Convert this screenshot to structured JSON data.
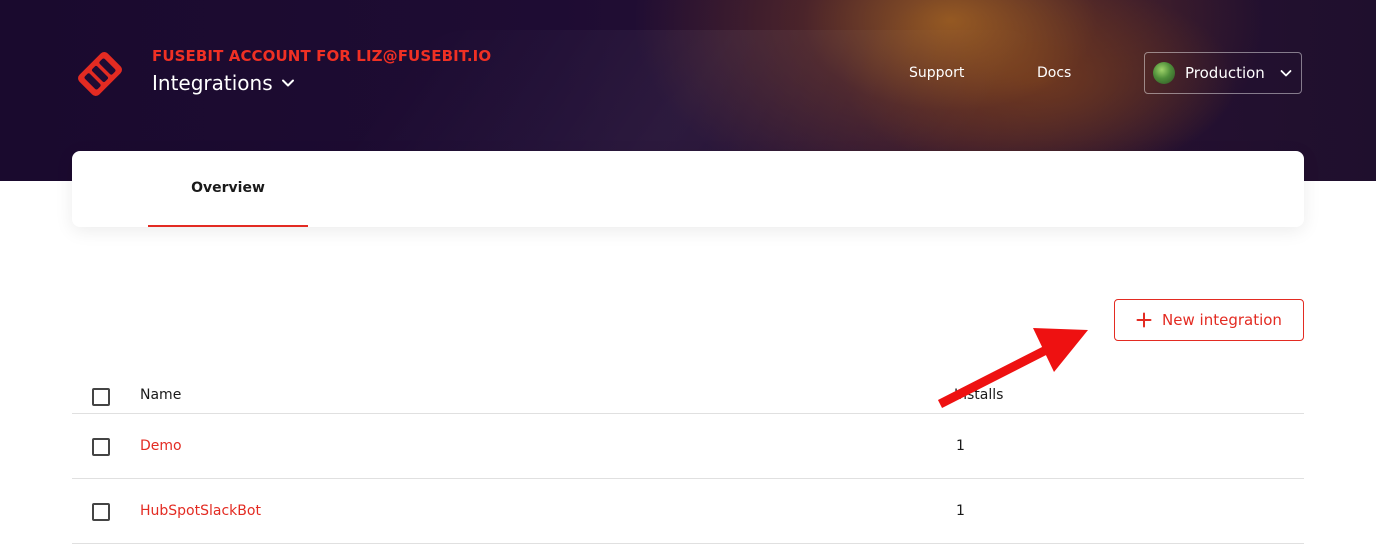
{
  "header": {
    "account_label": "FUSEBIT ACCOUNT FOR LIZ@FUSEBIT.IO",
    "page_title": "Integrations",
    "nav": {
      "support": "Support",
      "docs": "Docs"
    },
    "environment": {
      "selected": "Production"
    }
  },
  "tabs": [
    {
      "label": "Overview",
      "active": true
    }
  ],
  "actions": {
    "new_integration": "New integration"
  },
  "table": {
    "columns": [
      "Name",
      "Installs"
    ],
    "rows": [
      {
        "name": "Demo",
        "installs": "1"
      },
      {
        "name": "HubSpotSlackBot",
        "installs": "1"
      }
    ]
  },
  "colors": {
    "accent": "#e32b22",
    "header_bg": "#1a0a2e"
  }
}
